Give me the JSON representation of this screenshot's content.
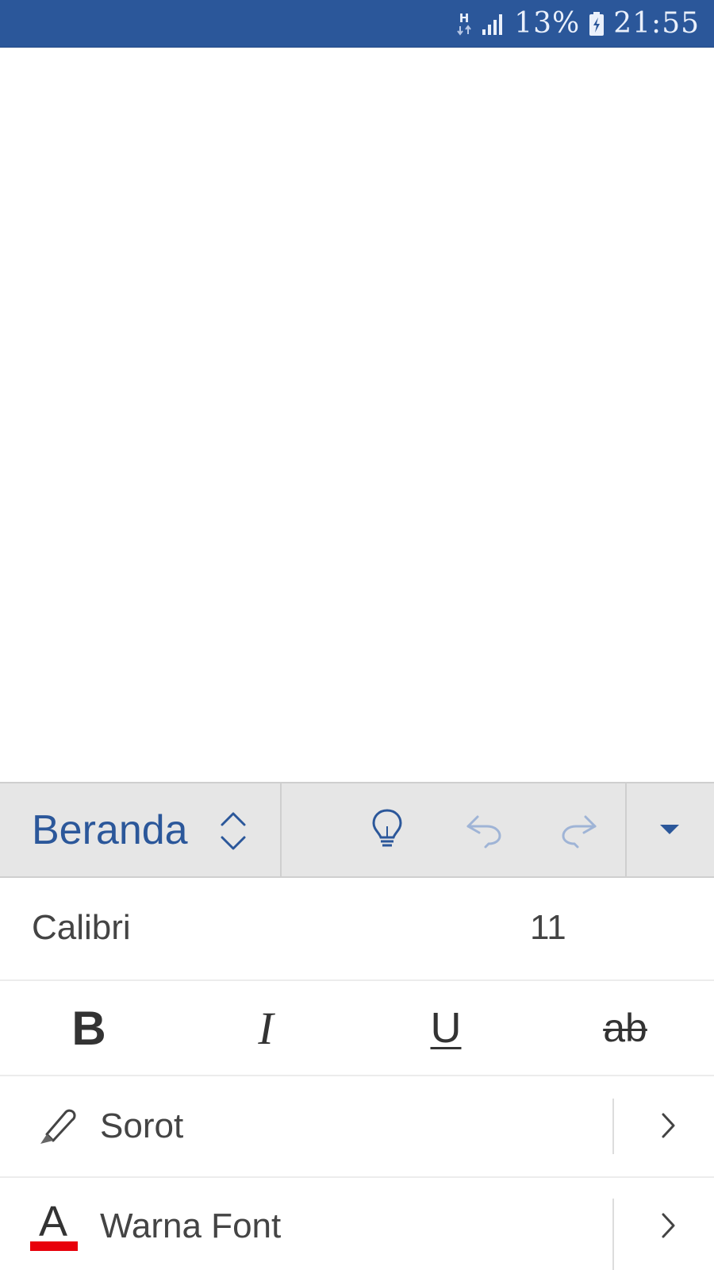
{
  "status_bar": {
    "network_type": "H",
    "battery_percent": "13%",
    "time": "21:55"
  },
  "ribbon": {
    "tab_label": "Beranda",
    "icons": [
      "tab-switcher-icon",
      "lightbulb-icon",
      "undo-icon",
      "redo-icon",
      "collapse-ribbon-icon"
    ]
  },
  "font": {
    "name": "Calibri",
    "size": "11"
  },
  "styles": {
    "bold": "B",
    "italic": "I",
    "underline": "U",
    "strikethrough": "ab"
  },
  "highlight": {
    "label": "Sorot"
  },
  "font_color": {
    "glyph": "A",
    "label": "Warna Font",
    "color": "#E8000B"
  },
  "colors": {
    "accent": "#2B579A",
    "ribbon_bg": "#E6E6E6"
  }
}
